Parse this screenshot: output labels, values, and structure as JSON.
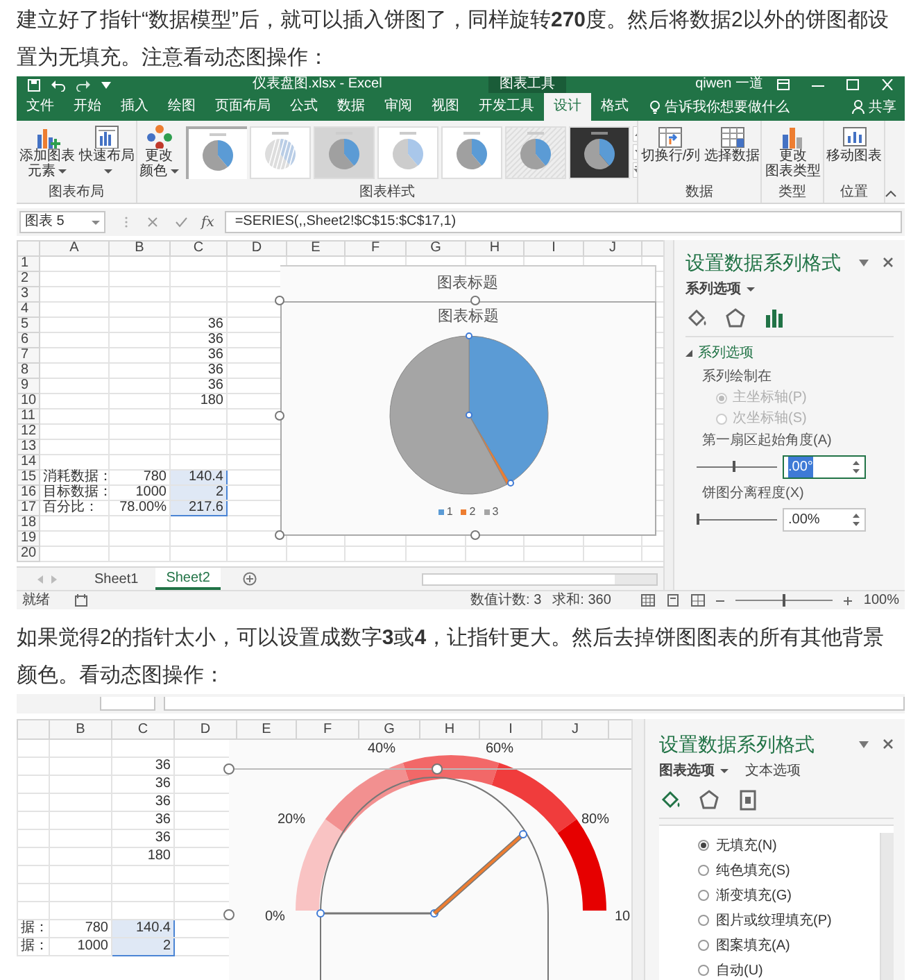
{
  "intro_paragraph": "建立好了指针“数据模型”后，就可以插入饼图了，同样旋转**270**度。然后将数据2以外的饼图都设置为无填充。注意看动态图操作：",
  "excel_1": {
    "title_bar": {
      "file_name": "仪表盘图.xlsx - Excel",
      "context_label": "图表工具",
      "user": "qiwen 一道"
    },
    "tabs": [
      {
        "label": "文件",
        "selected": false
      },
      {
        "label": "开始",
        "selected": false
      },
      {
        "label": "插入",
        "selected": false
      },
      {
        "label": "绘图",
        "selected": false
      },
      {
        "label": "页面布局",
        "selected": false
      },
      {
        "label": "公式",
        "selected": false
      },
      {
        "label": "数据",
        "selected": false
      },
      {
        "label": "审阅",
        "selected": false
      },
      {
        "label": "视图",
        "selected": false
      },
      {
        "label": "开发工具",
        "selected": false
      },
      {
        "label": "设计",
        "selected": true
      },
      {
        "label": "格式",
        "selected": false
      }
    ],
    "tell_me": "告诉我你想要做什么",
    "share": "共享",
    "ribbon_groups": [
      {
        "label": "图表布局",
        "buttons": [
          {
            "kind": "add_element",
            "label": [
              "添加图表",
              "元素"
            ],
            "dropdown": true
          },
          {
            "kind": "quick_layout",
            "label": [
              "快速布局"
            ],
            "dropdown": true
          }
        ]
      },
      {
        "label": "图表样式",
        "buttons": [
          {
            "kind": "colors",
            "label": [
              "更改",
              "颜色"
            ],
            "dropdown": true
          }
        ],
        "styles": [
          {
            "kind": "plain",
            "selected": true
          },
          {
            "kind": "hatched",
            "selected": false
          },
          {
            "kind": "shaded",
            "selected": false
          },
          {
            "kind": "light",
            "selected": false
          },
          {
            "kind": "plain",
            "selected": false
          },
          {
            "kind": "striped",
            "selected": false
          },
          {
            "kind": "dark",
            "selected": false
          }
        ]
      },
      {
        "label": "数据",
        "buttons": [
          {
            "kind": "switch",
            "label": [
              "切换行/列"
            ],
            "dropdown": false
          },
          {
            "kind": "select_data",
            "label": [
              "选择数据"
            ],
            "dropdown": false
          }
        ]
      },
      {
        "label": "类型",
        "buttons": [
          {
            "kind": "change_type",
            "label": [
              "更改",
              "图表类型"
            ],
            "dropdown": false
          }
        ]
      },
      {
        "label": "位置",
        "buttons": [
          {
            "kind": "move",
            "label": [
              "移动图表"
            ],
            "dropdown": false
          }
        ]
      }
    ],
    "name_box": "图表 5",
    "function_label": "fx",
    "formula": "=SERIES(,,Sheet2!$C$15:$C$17,1)",
    "columns": [
      "A",
      "B",
      "C",
      "D",
      "E",
      "F",
      "G",
      "H",
      "I",
      "J"
    ],
    "rows": [
      {
        "header": "1"
      },
      {
        "header": "2"
      },
      {
        "header": "3"
      },
      {
        "header": "4"
      },
      {
        "header": "5",
        "cells": {
          "c": {
            "kind": "number",
            "text": "36",
            "selected": false
          }
        }
      },
      {
        "header": "6",
        "cells": {
          "c": {
            "kind": "number",
            "text": "36",
            "selected": false
          }
        }
      },
      {
        "header": "7",
        "cells": {
          "c": {
            "kind": "number",
            "text": "36",
            "selected": false
          }
        }
      },
      {
        "header": "8",
        "cells": {
          "c": {
            "kind": "number",
            "text": "36",
            "selected": false
          }
        }
      },
      {
        "header": "9",
        "cells": {
          "c": {
            "kind": "number",
            "text": "36",
            "selected": false
          }
        }
      },
      {
        "header": "10",
        "cells": {
          "c": {
            "kind": "number",
            "text": "180",
            "selected": false
          }
        }
      },
      {
        "header": "11"
      },
      {
        "header": "12"
      },
      {
        "header": "13"
      },
      {
        "header": "14"
      },
      {
        "header": "15",
        "cells": {
          "a": {
            "kind": "text",
            "text": "消耗数据：",
            "selected": false
          },
          "b": {
            "kind": "number",
            "text": "780",
            "selected": false
          },
          "c": {
            "kind": "number",
            "text": "140.4",
            "selected": true
          }
        }
      },
      {
        "header": "16",
        "cells": {
          "a": {
            "kind": "text",
            "text": "目标数据：",
            "selected": false
          },
          "b": {
            "kind": "number",
            "text": "1000",
            "selected": false
          },
          "c": {
            "kind": "number",
            "text": "2",
            "selected": true
          }
        }
      },
      {
        "header": "17",
        "cells": {
          "a": {
            "kind": "text",
            "text": "百分比：",
            "selected": false
          },
          "b": {
            "kind": "number",
            "text": "78.00%",
            "selected": false
          },
          "c": {
            "kind": "number",
            "text": "217.6",
            "selected": true
          }
        }
      },
      {
        "header": "18"
      },
      {
        "header": "19"
      },
      {
        "header": "20"
      }
    ],
    "chart": {
      "back_title": "图表标题",
      "title": "图表标题",
      "legend": [
        {
          "label": "1",
          "color": "#5b9bd5"
        },
        {
          "label": "2",
          "color": "#ed7d31"
        },
        {
          "label": "3",
          "color": "#a5a5a5"
        }
      ]
    },
    "sheet_tabs": [
      {
        "label": "Sheet1",
        "selected": false
      },
      {
        "label": "Sheet2",
        "selected": true
      }
    ],
    "status_bar": {
      "ready": "就绪",
      "count": "数值计数: 3",
      "sum": "求和: 360",
      "zoom": "100%",
      "zoom_slider": {
        "level": 0.5
      }
    },
    "format_pane": {
      "title": "设置数据系列格式",
      "menus": [
        {
          "label": "系列选项",
          "selected": true,
          "dropdown": true
        }
      ],
      "icon_tabs": [
        {
          "kind": "fill",
          "selected": false
        },
        {
          "kind": "effects",
          "selected": false
        },
        {
          "kind": "series_options",
          "selected": true
        }
      ],
      "section": "系列选项",
      "plot_on_label": "系列绘制在",
      "radios": [
        {
          "label": "主坐标轴(P)",
          "selected": true,
          "disabled": true
        },
        {
          "label": "次坐标轴(S)",
          "selected": false,
          "disabled": true
        }
      ],
      "sliders": [
        {
          "label": "第一扇区起始角度(A)",
          "value": ".00°",
          "level": 0.47,
          "focused": true
        },
        {
          "label": "饼图分离程度(X)",
          "value": ".00%",
          "level": 0,
          "focused": false
        }
      ]
    }
  },
  "second_paragraph": "如果觉得2的指针太小，可以设置成数字**3**或**4**，让指针更大。然后去掉饼图图表的所有其他背景颜色。看动态图操作：",
  "excel_2": {
    "columns": [
      "B",
      "C",
      "D",
      "E",
      "F",
      "G",
      "H",
      "I",
      "J"
    ],
    "rows": [
      {},
      {
        "cells": {
          "c": {
            "kind": "number",
            "text": "36",
            "selected": false
          }
        }
      },
      {
        "cells": {
          "c": {
            "kind": "number",
            "text": "36",
            "selected": false
          }
        }
      },
      {
        "cells": {
          "c": {
            "kind": "number",
            "text": "36",
            "selected": false
          }
        }
      },
      {
        "cells": {
          "c": {
            "kind": "number",
            "text": "36",
            "selected": false
          }
        }
      },
      {
        "cells": {
          "c": {
            "kind": "number",
            "text": "36",
            "selected": false
          }
        }
      },
      {
        "cells": {
          "c": {
            "kind": "number",
            "text": "180",
            "selected": false
          }
        }
      },
      {},
      {},
      {},
      {
        "cells": {
          "a": {
            "text": "据：",
            "selected": false
          },
          "b": {
            "kind": "number",
            "text": "780",
            "selected": false
          },
          "c": {
            "kind": "number",
            "text": "140.4",
            "selected": true
          }
        }
      },
      {
        "cells": {
          "a": {
            "text": "据：",
            "selected": false
          },
          "b": {
            "kind": "number",
            "text": "1000",
            "selected": false
          },
          "c": {
            "kind": "number",
            "text": "2",
            "selected": true
          }
        }
      }
    ],
    "gauge": {
      "segments": [
        {
          "color": "#f9c3c3"
        },
        {
          "color": "#f29090"
        },
        {
          "color": "#f26868"
        },
        {
          "color": "#f03c3c"
        },
        {
          "color": "#e60000"
        }
      ],
      "scale_labels": [
        "0%",
        "20%",
        "40%",
        "60%",
        "80%",
        "10"
      ]
    },
    "format_pane": {
      "title": "设置数据系列格式",
      "menus": [
        {
          "label": "图表选项",
          "selected": true,
          "dropdown": true
        },
        {
          "label": "文本选项",
          "selected": false,
          "dropdown": false
        }
      ],
      "icon_tabs": [
        {
          "kind": "fill",
          "selected": true
        },
        {
          "kind": "effects",
          "selected": false
        },
        {
          "kind": "size",
          "selected": false
        }
      ],
      "fill_options": [
        {
          "label": "无填充(N)",
          "selected": true
        },
        {
          "label": "纯色填充(S)",
          "selected": false
        },
        {
          "label": "渐变填充(G)",
          "selected": false
        },
        {
          "label": "图片或纹理填充(P)",
          "selected": false
        },
        {
          "label": "图案填充(A)",
          "selected": false
        },
        {
          "label": "自动(U)",
          "selected": false
        }
      ]
    }
  }
}
